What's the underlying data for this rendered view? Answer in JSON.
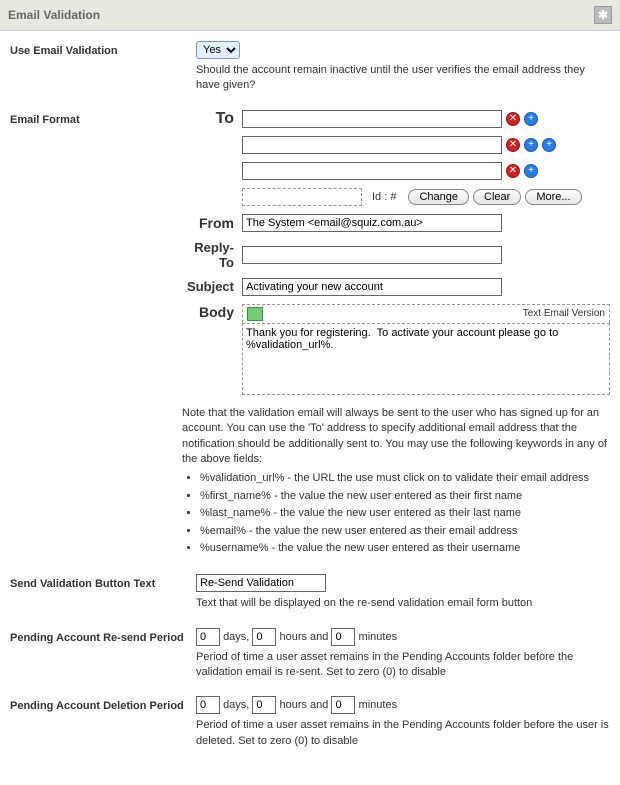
{
  "titlebar": {
    "title": "Email Validation"
  },
  "use_validation": {
    "label": "Use Email Validation",
    "value": "Yes",
    "help": "Should the account remain inactive until the user verifies the email address they have given?"
  },
  "email_format": {
    "label": "Email Format",
    "to_label": "To",
    "to_values": [
      "",
      "",
      ""
    ],
    "id_label": "Id : #",
    "buttons": {
      "change": "Change",
      "clear": "Clear",
      "more": "More..."
    },
    "from_label": "From",
    "from_value": "The System <email@squiz.com.au>",
    "replyto_label": "Reply-To",
    "replyto_value": "",
    "subject_label": "Subject",
    "subject_value": "Activating your new account",
    "body_label": "Body",
    "text_version_label": "Text Email Version",
    "body_value": "Thank you for registering.  To activate your account please go to %validation_url%.",
    "note_intro": "Note that the validation email will always be sent to the user who has signed up for an account. You can use the 'To' address to specify additional email address that the notification should be additionally sent to. You may use the following keywords in any of the above fields:",
    "keywords": [
      "%validation_url% - the URL the use must click on to validate their email address",
      "%first_name% - the value the new user entered as their first name",
      "%last_name% - the value the new user entered as their last name",
      "%email% - the value the new user entered as their email address",
      "%username% - the value the new user entered as their username"
    ]
  },
  "button_text": {
    "label": "Send Validation Button Text",
    "value": "Re-Send Validation",
    "help": "Text that will be displayed on the re-send validation email form button"
  },
  "resend_period": {
    "label": "Pending Account Re-send Period",
    "days": "0",
    "days_label": "days,",
    "hours": "0",
    "hours_label": "hours and",
    "minutes": "0",
    "minutes_label": "minutes",
    "help": "Period of time a user asset remains in the Pending Accounts folder before the validation email is re-sent. Set to zero (0) to disable"
  },
  "delete_period": {
    "label": "Pending Account Deletion Period",
    "days": "0",
    "days_label": "days,",
    "hours": "0",
    "hours_label": "hours and",
    "minutes": "0",
    "minutes_label": "minutes",
    "help": "Period of time a user asset remains in the Pending Accounts folder before the user is deleted. Set to zero (0) to disable"
  }
}
